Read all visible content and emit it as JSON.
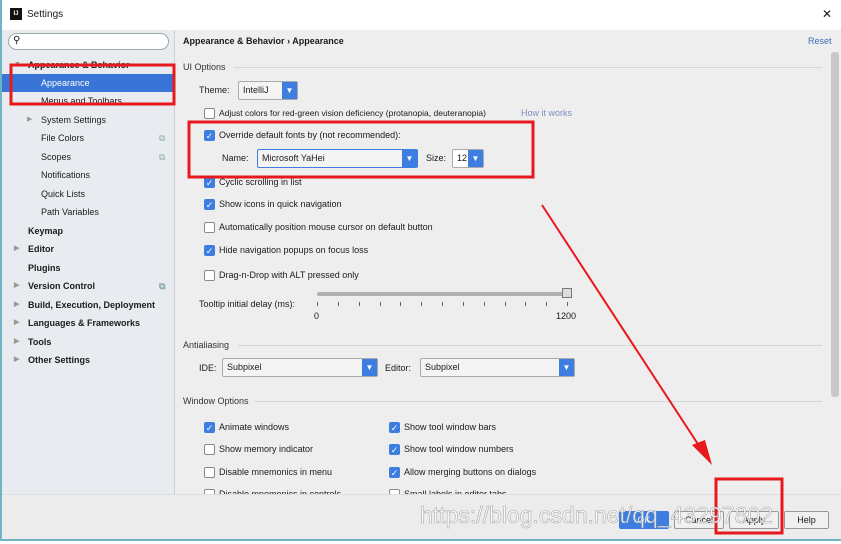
{
  "window": {
    "title": "Settings",
    "close": "✕"
  },
  "search": {
    "placeholder": ""
  },
  "sidebar": {
    "items": [
      {
        "label": "Appearance & Behavior",
        "bold": true
      },
      {
        "label": "Appearance",
        "selected": true
      },
      {
        "label": "Menus and Toolbars"
      },
      {
        "label": "System Settings"
      },
      {
        "label": "File Colors"
      },
      {
        "label": "Scopes"
      },
      {
        "label": "Notifications"
      },
      {
        "label": "Quick Lists"
      },
      {
        "label": "Path Variables"
      },
      {
        "label": "Keymap"
      },
      {
        "label": "Editor"
      },
      {
        "label": "Plugins"
      },
      {
        "label": "Version Control"
      },
      {
        "label": "Build, Execution, Deployment"
      },
      {
        "label": "Languages & Frameworks"
      },
      {
        "label": "Tools"
      },
      {
        "label": "Other Settings"
      }
    ]
  },
  "breadcrumb": {
    "parent": "Appearance & Behavior",
    "sep": "›",
    "current": "Appearance"
  },
  "reset": "Reset",
  "ui_options": {
    "title": "UI Options",
    "theme_label": "Theme:",
    "theme": "IntelliJ",
    "adjust_colors": {
      "label": "Adjust colors for red-green vision deficiency (protanopia, deuteranopia)",
      "checked": false
    },
    "how_it_works": "How it works",
    "override_fonts": {
      "label": "Override default fonts by (not recommended):",
      "checked": true
    },
    "name_label": "Name:",
    "font_name": "Microsoft YaHei",
    "size_label": "Size:",
    "font_size": "12",
    "cyclic": {
      "label": "Cyclic scrolling in list",
      "checked": true
    },
    "show_icons": {
      "label": "Show icons in quick navigation",
      "checked": true
    },
    "auto_position": {
      "label": "Automatically position mouse cursor on default button",
      "checked": false
    },
    "hide_popups": {
      "label": "Hide navigation popups on focus loss",
      "checked": true
    },
    "drag_drop": {
      "label": "Drag-n-Drop with ALT pressed only",
      "checked": false
    },
    "tooltip_label": "Tooltip initial delay (ms):",
    "tooltip_min": "0",
    "tooltip_max": "1200",
    "tooltip_value": 1200
  },
  "antialiasing": {
    "title": "Antialiasing",
    "ide_label": "IDE:",
    "ide": "Subpixel",
    "editor_label": "Editor:",
    "editor": "Subpixel"
  },
  "window_options": {
    "title": "Window Options",
    "items": [
      {
        "label": "Animate windows",
        "checked": true
      },
      {
        "label": "Show tool window bars",
        "checked": true
      },
      {
        "label": "Show memory indicator",
        "checked": false
      },
      {
        "label": "Show tool window numbers",
        "checked": true
      },
      {
        "label": "Disable mnemonics in menu",
        "checked": false
      },
      {
        "label": "Allow merging buttons on dialogs",
        "checked": true
      },
      {
        "label": "Disable mnemonics in controls",
        "checked": false
      },
      {
        "label": "Small labels in editor tabs",
        "checked": false
      }
    ]
  },
  "buttons": {
    "ok": "OK",
    "cancel": "Cancel",
    "apply": "Apply",
    "help": "Help"
  },
  "watermark": "https://blog.csdn.net/qq_43297802",
  "annotation_color": "#e8191c",
  "accent": "#3875d7"
}
